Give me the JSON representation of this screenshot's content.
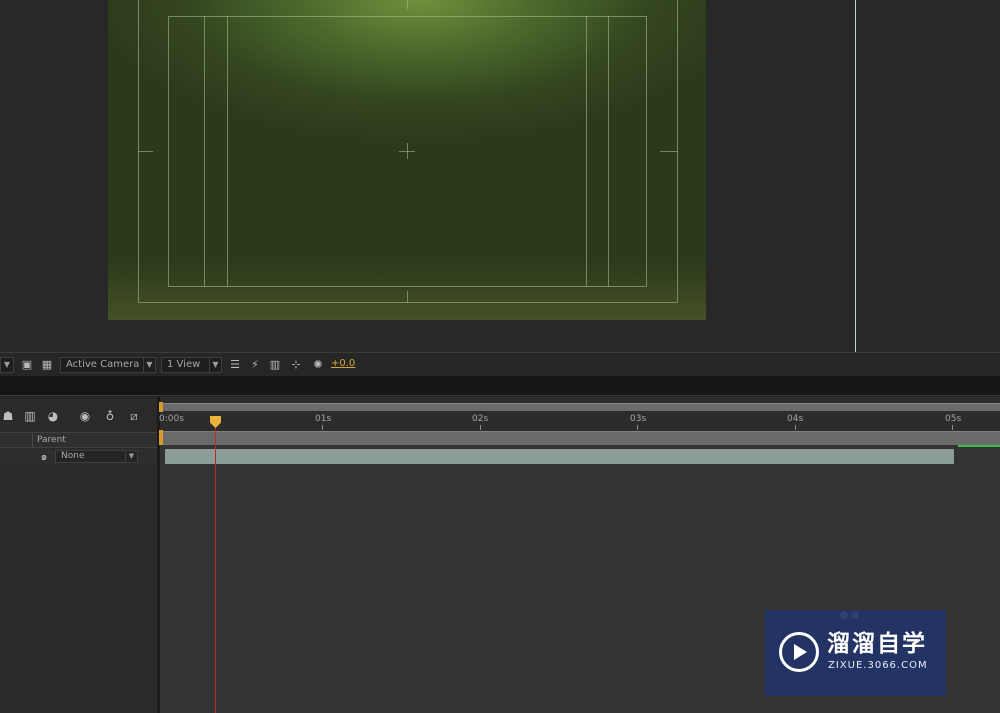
{
  "viewer_toolbar": {
    "camera_view": "Active Camera",
    "view_layout": "1 View",
    "exposure": "+0.0",
    "icons": [
      "region-of-interest-icon",
      "transparency-grid-icon",
      "draft-3d-icon",
      "fast-preview-icon",
      "timeline-icon",
      "flowchart-icon",
      "exposure-reset-icon"
    ]
  },
  "timeline": {
    "switch_icons": [
      "draft-3d-icon",
      "hide-shy-icon",
      "frame-blending-icon",
      "motion-blur-icon",
      "brainstorm-icon",
      "graph-editor-icon"
    ],
    "column_header": {
      "parent_label": "Parent"
    },
    "layer": {
      "parent_value": "None"
    },
    "ruler": {
      "ticks": [
        {
          "label": "0:00s"
        },
        {
          "label": "01s"
        },
        {
          "label": "02s"
        },
        {
          "label": "03s"
        },
        {
          "label": "04s"
        },
        {
          "label": "05s"
        }
      ]
    }
  },
  "watermark": {
    "brand": "溜溜自学",
    "url": "ZIXUE.3066.COM"
  },
  "colors": {
    "comp_background": "#4c6a2c",
    "playhead": "#e9b43c",
    "playhead_line": "#c0282c",
    "layer_bar": "#8c9c99",
    "exposure_text": "#d8a43a",
    "watermark_bg": "#223468"
  }
}
